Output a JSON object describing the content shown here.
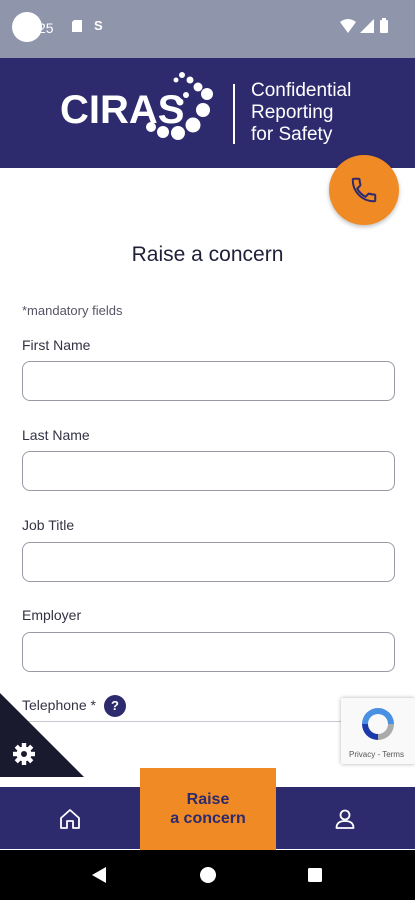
{
  "status_bar": {
    "time": "25",
    "icons": [
      "sd-card-icon",
      "s-icon",
      "wifi-icon",
      "signal-icon",
      "battery-icon"
    ]
  },
  "header": {
    "logo_text": "CIRAS",
    "tagline_line1": "Confidential",
    "tagline_line2": "Reporting",
    "tagline_line3": "for Safety"
  },
  "page": {
    "title": "Raise a concern",
    "mandatory_note": "*mandatory fields"
  },
  "form": {
    "first_name_label": "First Name",
    "first_name_value": "",
    "last_name_label": "Last Name",
    "last_name_value": "",
    "job_title_label": "Job Title",
    "job_title_value": "",
    "employer_label": "Employer",
    "employer_value": "",
    "telephone_label": "Telephone *",
    "help_glyph": "?"
  },
  "recaptcha": {
    "links": "Privacy - Terms"
  },
  "bottom_nav": {
    "raise_line1": "Raise",
    "raise_line2": "a concern"
  },
  "colors": {
    "brand_navy": "#2d2a6e",
    "accent_orange": "#f08a24",
    "status_bar": "#8f96ab"
  }
}
